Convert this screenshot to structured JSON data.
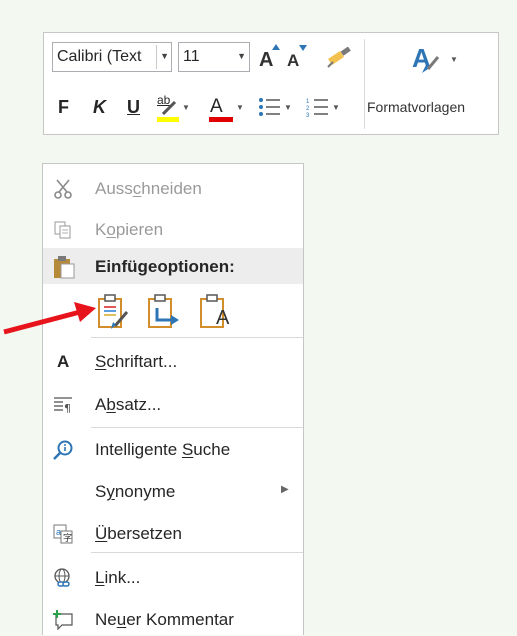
{
  "toolbar": {
    "font_name": "Calibri (Text",
    "font_size": "11",
    "styles_label": "Formatvorlagen",
    "bold_glyph": "F",
    "italic_glyph": "K",
    "underline_glyph": "U",
    "highlight_glyph": "ab",
    "font_color_glyph": "A",
    "grow_font_glyph": "A",
    "shrink_font_glyph": "A",
    "highlight_color": "#ffff00",
    "font_color": "#e00000"
  },
  "menu": {
    "cut": {
      "pre": "Auss",
      "u": "c",
      "post": "hneiden"
    },
    "copy": {
      "pre": "K",
      "u": "o",
      "post": "pieren"
    },
    "paste_header": "Einfügeoptionen:",
    "font": {
      "pre": "",
      "u": "S",
      "post": "chriftart..."
    },
    "paragraph": {
      "pre": "A",
      "u": "b",
      "post": "satz..."
    },
    "smart_lookup": {
      "pre": "Intelligente ",
      "u": "S",
      "post": "uche"
    },
    "synonyms": {
      "pre": "S",
      "u": "y",
      "post": "nonyme"
    },
    "translate": {
      "pre": "",
      "u": "Ü",
      "post": "bersetzen"
    },
    "link": {
      "pre": "",
      "u": "L",
      "post": "ink..."
    },
    "new_comment": {
      "pre": "Ne",
      "u": "u",
      "post": "er Kommentar"
    },
    "font_icon_glyph": "A",
    "paste_text_glyph": "A"
  },
  "colors": {
    "background": "#f3f8f0",
    "arrow": "#e8141c",
    "icon_blue": "#2e75b6",
    "icon_orange": "#e2a33a"
  }
}
